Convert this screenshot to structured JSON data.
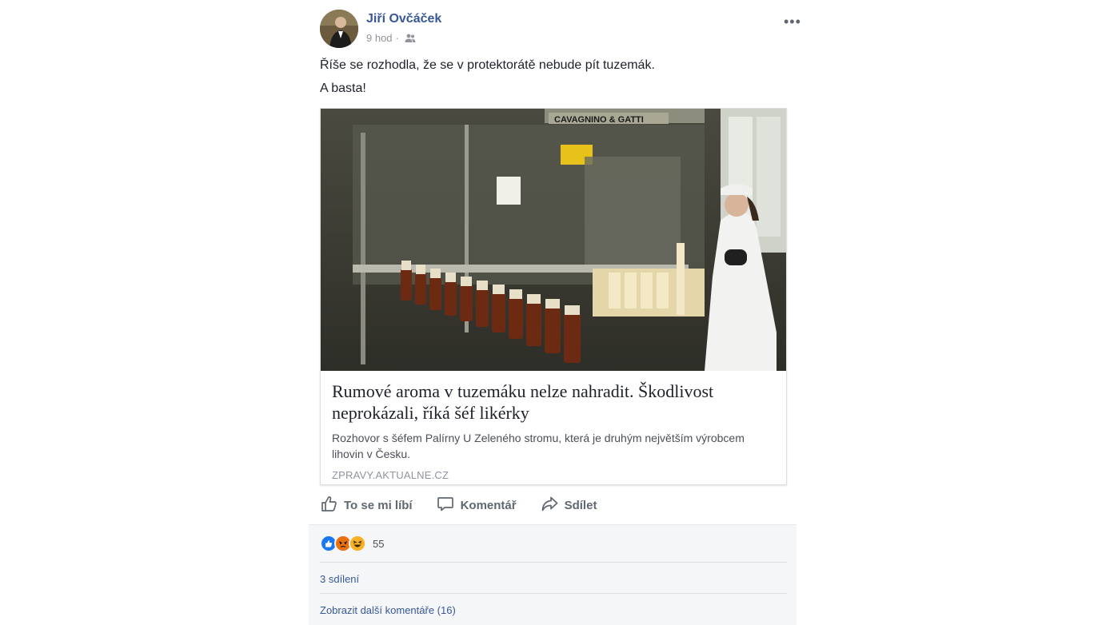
{
  "post": {
    "author": "Jiří Ovčáček",
    "time": "9 hod",
    "separator": "·",
    "audience_icon": "friends-icon",
    "more_icon": "more-options-icon",
    "text_lines": [
      "Říše se rozhodla, že se v protektorátě nebude pít tuzemák.",
      "A basta!"
    ]
  },
  "link_preview": {
    "image_label": "CAVAGNINO & GATTI",
    "title": "Rumové aroma v tuzemáku nelze nahradit. Škodlivost neprokázali, říká šéf likérky",
    "description": "Rozhovor s šéfem Palírny U Zeleného stromu, která je druhým největším výrobcem lihovin v Česku.",
    "domain": "ZPRAVY.AKTUALNE.CZ"
  },
  "actions": {
    "like": "To se mi líbí",
    "comment": "Komentář",
    "share": "Sdílet"
  },
  "footer": {
    "reaction_icons": [
      "like-icon",
      "angry-icon",
      "haha-icon"
    ],
    "reaction_count": "55",
    "shares": "3 sdílení",
    "more_comments": "Zobrazit další komentáře (16)"
  },
  "colors": {
    "link_blue": "#385898",
    "like_blue": "#1877f2",
    "angry_orange": "#e9710f",
    "haha_yellow": "#f7b125"
  }
}
